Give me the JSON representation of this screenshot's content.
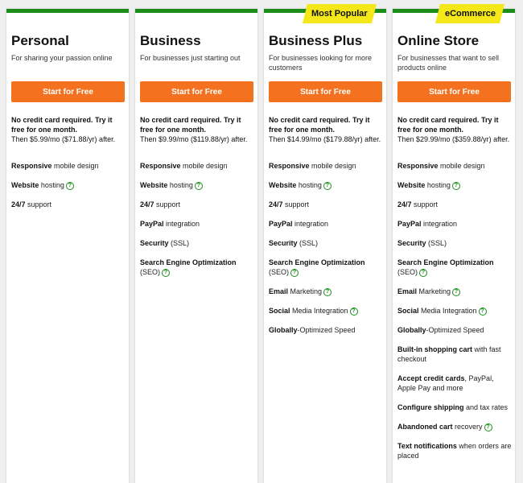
{
  "plans": [
    {
      "title": "Personal",
      "subtitle": "For sharing your passion online",
      "cta": "Start for Free",
      "notice_bold": "No credit card required. Try it free for one month.",
      "notice_price": "Then $5.99/mo ($71.88/yr) after.",
      "features": [
        {
          "strong": "Responsive",
          "rest": " mobile design",
          "help": false
        },
        {
          "strong": "Website",
          "rest": " hosting",
          "help": true
        },
        {
          "strong": "24/7",
          "rest": " support",
          "help": false
        }
      ]
    },
    {
      "title": "Business",
      "subtitle": "For businesses just starting out",
      "cta": "Start for Free",
      "notice_bold": "No credit card required. Try it free for one month.",
      "notice_price": "Then $9.99/mo ($119.88/yr) after.",
      "features": [
        {
          "strong": "Responsive",
          "rest": " mobile design",
          "help": false
        },
        {
          "strong": "Website",
          "rest": " hosting",
          "help": true
        },
        {
          "strong": "24/7",
          "rest": " support",
          "help": false
        },
        {
          "strong": "PayPal",
          "rest": " integration",
          "help": false
        },
        {
          "strong": "Security",
          "rest": " (SSL)",
          "help": false
        },
        {
          "strong": "Search Engine Optimization",
          "rest": " (SEO)",
          "help": true
        }
      ]
    },
    {
      "title": "Business Plus",
      "subtitle": "For businesses looking for more customers",
      "cta": "Start for Free",
      "badge": "Most Popular",
      "notice_bold": "No credit card required. Try it free for one month.",
      "notice_price": "Then $14.99/mo ($179.88/yr) after.",
      "features": [
        {
          "strong": "Responsive",
          "rest": " mobile design",
          "help": false
        },
        {
          "strong": "Website",
          "rest": " hosting",
          "help": true
        },
        {
          "strong": "24/7",
          "rest": " support",
          "help": false
        },
        {
          "strong": "PayPal",
          "rest": " integration",
          "help": false
        },
        {
          "strong": "Security",
          "rest": " (SSL)",
          "help": false
        },
        {
          "strong": "Search Engine Optimization",
          "rest": " (SEO)",
          "help": true
        },
        {
          "strong": "Email",
          "rest": " Marketing",
          "help": true
        },
        {
          "strong": "Social",
          "rest": " Media Integration",
          "help": true
        },
        {
          "strong": "Globally",
          "rest": "-Optimized Speed",
          "help": false
        }
      ]
    },
    {
      "title": "Online Store",
      "subtitle": "For businesses that want to sell products online",
      "cta": "Start for Free",
      "badge": "eCommerce",
      "notice_bold": "No credit card required. Try it free for one month.",
      "notice_price": "Then $29.99/mo ($359.88/yr) after.",
      "features": [
        {
          "strong": "Responsive",
          "rest": " mobile design",
          "help": false
        },
        {
          "strong": "Website",
          "rest": " hosting",
          "help": true
        },
        {
          "strong": "24/7",
          "rest": " support",
          "help": false
        },
        {
          "strong": "PayPal",
          "rest": " integration",
          "help": false
        },
        {
          "strong": "Security",
          "rest": " (SSL)",
          "help": false
        },
        {
          "strong": "Search Engine Optimization",
          "rest": " (SEO)",
          "help": true
        },
        {
          "strong": "Email",
          "rest": " Marketing",
          "help": true
        },
        {
          "strong": "Social",
          "rest": " Media Integration",
          "help": true
        },
        {
          "strong": "Globally",
          "rest": "-Optimized Speed",
          "help": false
        },
        {
          "strong": "Built-in shopping cart",
          "rest": " with fast checkout",
          "help": false
        },
        {
          "strong": "Accept credit cards",
          "rest": ", PayPal, Apple Pay and more",
          "help": false
        },
        {
          "strong": "Configure shipping",
          "rest": " and tax rates",
          "help": false
        },
        {
          "strong": "Abandoned cart",
          "rest": " recovery",
          "help": true
        },
        {
          "strong": "Text notifications",
          "rest": " when orders are placed",
          "help": false
        }
      ]
    }
  ],
  "help_glyph": "?",
  "colors": {
    "accent_green": "#1a8d1a",
    "cta_orange": "#f3711f",
    "badge_yellow": "#f5e81a"
  }
}
